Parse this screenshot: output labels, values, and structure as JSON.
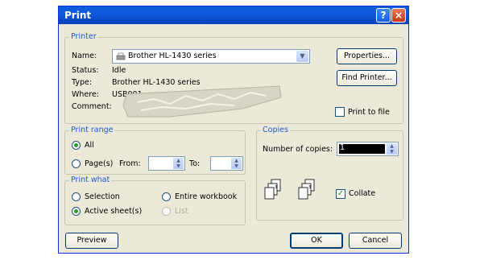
{
  "window": {
    "title": "Print",
    "help_icon": "?",
    "close_icon": "×"
  },
  "printer": {
    "legend": "Printer",
    "name_label": "Name:",
    "name_value": "Brother HL-1430 series",
    "status_label": "Status:",
    "status_value": "Idle",
    "type_label": "Type:",
    "type_value": "Brother HL-1430 series",
    "where_label": "Where:",
    "where_value": "USB001",
    "comment_label": "Comment:",
    "properties_button": "Properties...",
    "find_printer_button": "Find Printer...",
    "print_to_file_label": "Print to file",
    "print_to_file_checked": false
  },
  "print_range": {
    "legend": "Print range",
    "all_label": "All",
    "pages_label": "Page(s)",
    "from_label": "From:",
    "to_label": "To:",
    "selected": "all"
  },
  "copies": {
    "legend": "Copies",
    "number_label": "Number of copies:",
    "number_value": "1",
    "collate_label": "Collate",
    "collate_checked": true
  },
  "print_what": {
    "legend": "Print what",
    "selection_label": "Selection",
    "entire_workbook_label": "Entire workbook",
    "active_sheets_label": "Active sheet(s)",
    "list_label": "List",
    "selected": "active_sheets"
  },
  "footer": {
    "preview_button": "Preview",
    "ok_button": "OK",
    "cancel_button": "Cancel"
  },
  "colors": {
    "titlebar": "#0a5fd8",
    "dialog_bg": "#ece9d8",
    "legend_text": "#1c56d8"
  }
}
